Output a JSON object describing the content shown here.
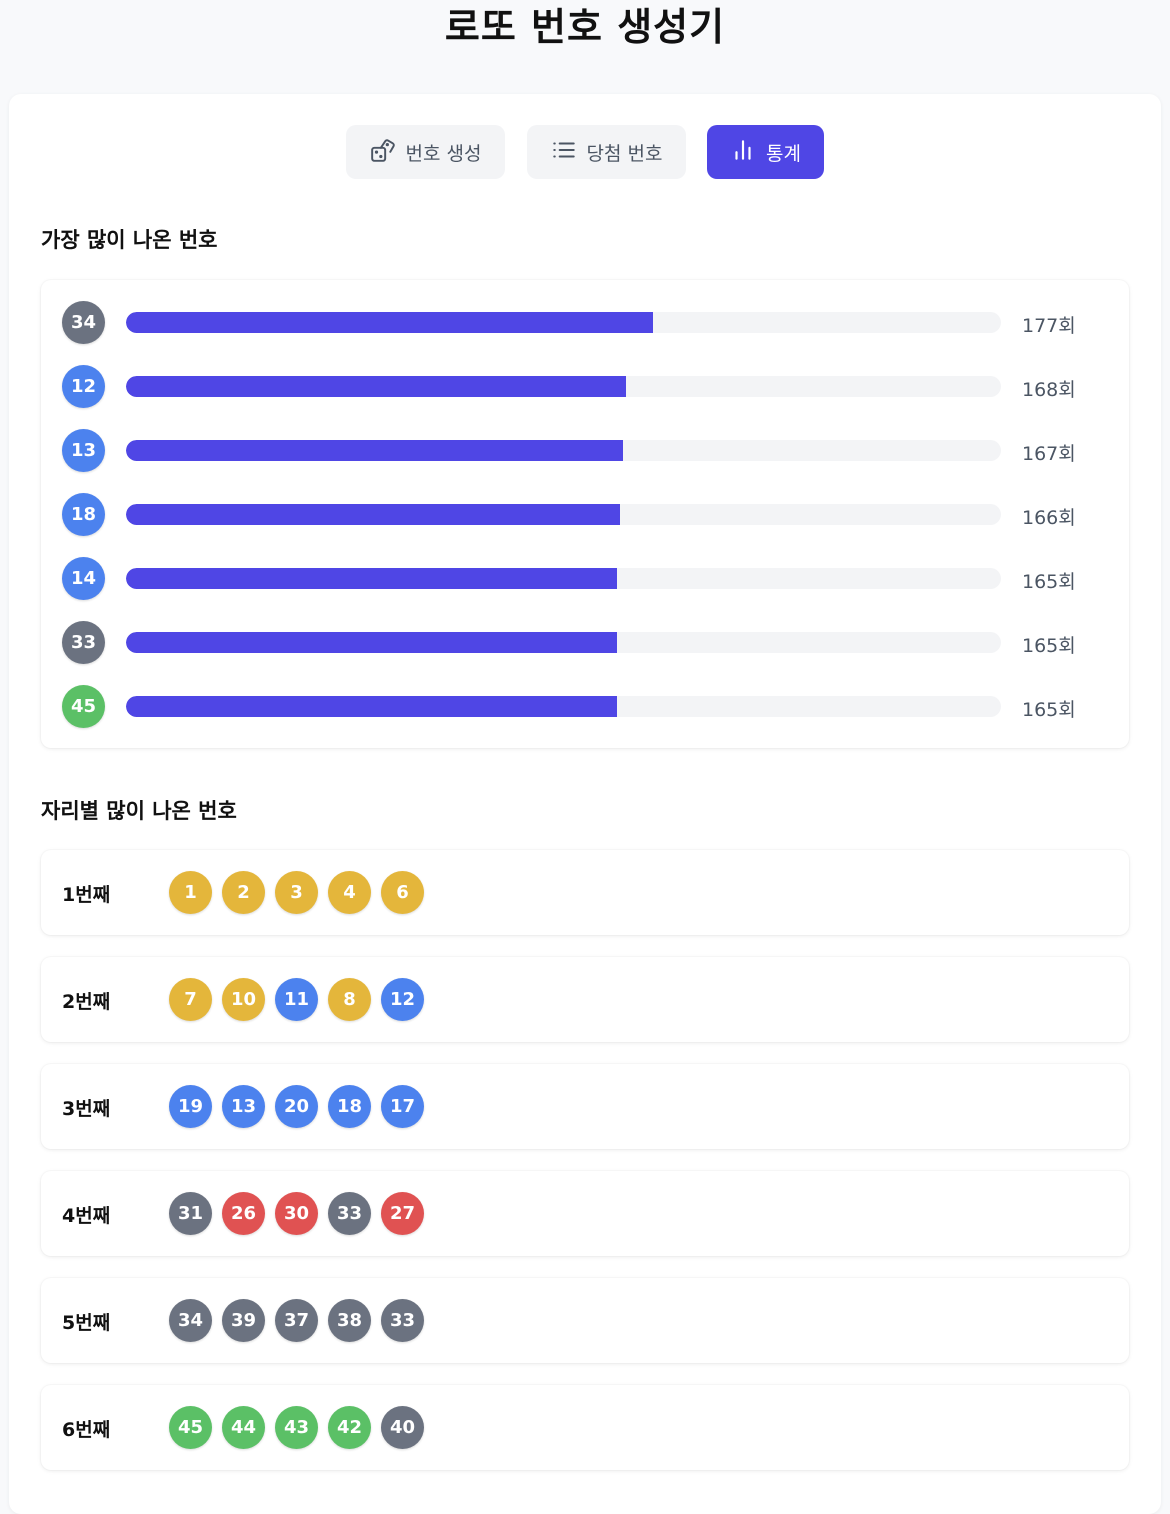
{
  "title": "로또 번호 생성기",
  "tabs": [
    {
      "label": "번호 생성",
      "icon": "dice-icon",
      "active": false
    },
    {
      "label": "당첨 번호",
      "icon": "list-icon",
      "active": false
    },
    {
      "label": "통계",
      "icon": "bar-chart-icon",
      "active": true
    }
  ],
  "most_frequent": {
    "title": "가장 많이 나온 번호",
    "max_count_scale": 294,
    "items": [
      {
        "number": "34",
        "count": 177,
        "count_label": "177회",
        "color": "#6b7280"
      },
      {
        "number": "12",
        "count": 168,
        "count_label": "168회",
        "color": "#4c82ee"
      },
      {
        "number": "13",
        "count": 167,
        "count_label": "167회",
        "color": "#4c82ee"
      },
      {
        "number": "18",
        "count": 166,
        "count_label": "166회",
        "color": "#4c82ee"
      },
      {
        "number": "14",
        "count": 165,
        "count_label": "165회",
        "color": "#4c82ee"
      },
      {
        "number": "33",
        "count": 165,
        "count_label": "165회",
        "color": "#6b7280"
      },
      {
        "number": "45",
        "count": 165,
        "count_label": "165회",
        "color": "#5bc066"
      }
    ]
  },
  "by_position": {
    "title": "자리별 많이 나온 번호",
    "rows": [
      {
        "label": "1번째",
        "numbers": [
          "1",
          "2",
          "3",
          "4",
          "6"
        ],
        "colors": [
          "#e4b63b",
          "#e4b63b",
          "#e4b63b",
          "#e4b63b",
          "#e4b63b"
        ]
      },
      {
        "label": "2번째",
        "numbers": [
          "7",
          "10",
          "11",
          "8",
          "12"
        ],
        "colors": [
          "#e4b63b",
          "#e4b63b",
          "#4c82ee",
          "#e4b63b",
          "#4c82ee"
        ]
      },
      {
        "label": "3번째",
        "numbers": [
          "19",
          "13",
          "20",
          "18",
          "17"
        ],
        "colors": [
          "#4c82ee",
          "#4c82ee",
          "#4c82ee",
          "#4c82ee",
          "#4c82ee"
        ]
      },
      {
        "label": "4번째",
        "numbers": [
          "31",
          "26",
          "30",
          "33",
          "27"
        ],
        "colors": [
          "#6b7280",
          "#e05252",
          "#e05252",
          "#6b7280",
          "#e05252"
        ]
      },
      {
        "label": "5번째",
        "numbers": [
          "34",
          "39",
          "37",
          "38",
          "33"
        ],
        "colors": [
          "#6b7280",
          "#6b7280",
          "#6b7280",
          "#6b7280",
          "#6b7280"
        ]
      },
      {
        "label": "6번째",
        "numbers": [
          "45",
          "44",
          "43",
          "42",
          "40"
        ],
        "colors": [
          "#5bc066",
          "#5bc066",
          "#5bc066",
          "#5bc066",
          "#6b7280"
        ]
      }
    ]
  }
}
